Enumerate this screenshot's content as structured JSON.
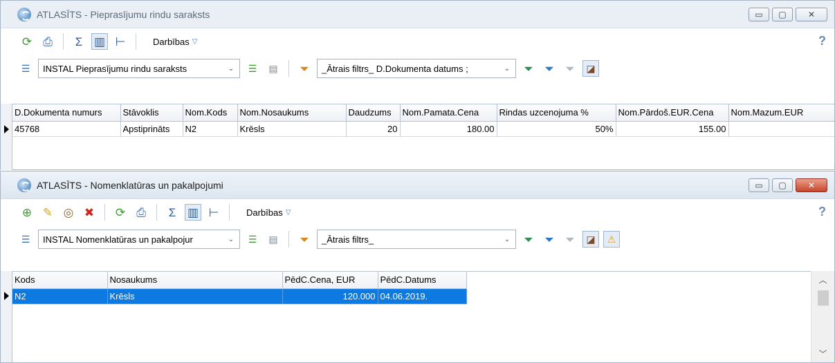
{
  "window1": {
    "title": "ATLASĪTS - Pieprasījumu rindu saraksts",
    "toolbar": {
      "actions_label": "Darbības"
    },
    "layout_select": "INSTAL Pieprasījumu rindu saraksts",
    "filter_select": "_Ātrais filtrs_ D.Dokumenta datums ;",
    "columns": [
      "D.Dokumenta numurs",
      "Stāvoklis",
      "Nom.Kods",
      "Nom.Nosaukums",
      "Daudzums",
      "Nom.Pamata.Cena",
      "Rindas uzcenojuma %",
      "Nom.Pārdoš.EUR.Cena",
      "Nom.Mazum.EUR"
    ],
    "rows": [
      [
        "45768",
        "Apstiprināts",
        "N2",
        "Krēsls",
        "20",
        "180.00",
        "50%",
        "155.00",
        ""
      ]
    ]
  },
  "window2": {
    "title": "ATLASĪTS - Nomenklatūras un pakalpojumi",
    "toolbar": {
      "actions_label": "Darbības"
    },
    "layout_select": "INSTAL Nomenklatūras un pakalpojur",
    "filter_select": "_Ātrais filtrs_",
    "columns": [
      "Kods",
      "Nosaukums",
      "PēdC.Cena, EUR",
      "PēdC.Datums"
    ],
    "rows": [
      [
        "N2",
        "Krēsls",
        "120.000",
        "04.06.2019."
      ]
    ]
  },
  "help_glyph": "?"
}
